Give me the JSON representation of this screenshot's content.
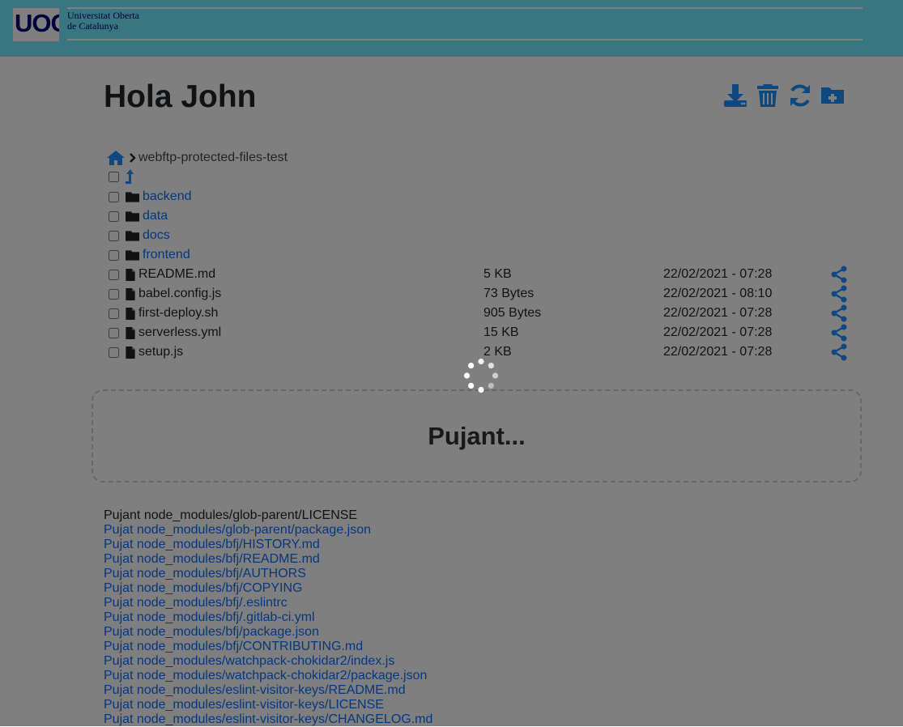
{
  "header": {
    "logo_mark": "UOC",
    "logo_line1": "Universitat Oberta",
    "logo_line2": "de Catalunya"
  },
  "greeting": "Hola John",
  "toolbar": [
    {
      "icon": "download-icon"
    },
    {
      "icon": "trash-icon"
    },
    {
      "icon": "refresh-icon"
    },
    {
      "icon": "folder-plus-icon"
    }
  ],
  "breadcrumb": {
    "home_icon": "home-icon",
    "current": "webftp-protected-files-test"
  },
  "folders": [
    {
      "name": "backend"
    },
    {
      "name": "data"
    },
    {
      "name": "docs"
    },
    {
      "name": "frontend"
    }
  ],
  "files": [
    {
      "name": "README.md",
      "size": "5 KB",
      "date": "22/02/2021 - 07:28"
    },
    {
      "name": "babel.config.js",
      "size": "73 Bytes",
      "date": "22/02/2021 - 08:10"
    },
    {
      "name": "first-deploy.sh",
      "size": "905 Bytes",
      "date": "22/02/2021 - 07:28"
    },
    {
      "name": "serverless.yml",
      "size": "15 KB",
      "date": "22/02/2021 - 07:28"
    },
    {
      "name": "setup.js",
      "size": "2 KB",
      "date": "22/02/2021 - 07:28"
    }
  ],
  "dropzone": {
    "text": "Pujant..."
  },
  "log": [
    "Pujant node_modules/glob-parent/LICENSE",
    "Pujat node_modules/glob-parent/package.json",
    "Pujat node_modules/bfj/HISTORY.md",
    "Pujat node_modules/bfj/README.md",
    "Pujat node_modules/bfj/AUTHORS",
    "Pujat node_modules/bfj/COPYING",
    "Pujat node_modules/bfj/.eslintrc",
    "Pujat node_modules/bfj/.gitlab-ci.yml",
    "Pujat node_modules/bfj/package.json",
    "Pujat node_modules/bfj/CONTRIBUTING.md",
    "Pujat node_modules/watchpack-chokidar2/index.js",
    "Pujat node_modules/watchpack-chokidar2/package.json",
    "Pujat node_modules/eslint-visitor-keys/README.md",
    "Pujat node_modules/eslint-visitor-keys/LICENSE",
    "Pujat node_modules/eslint-visitor-keys/CHANGELOG.md"
  ],
  "colors": {
    "header_bg": "#73edff",
    "brand_blue": "#000078",
    "link_blue": "#0d6efd",
    "overlay": "rgba(0,0,0,0.5)"
  }
}
